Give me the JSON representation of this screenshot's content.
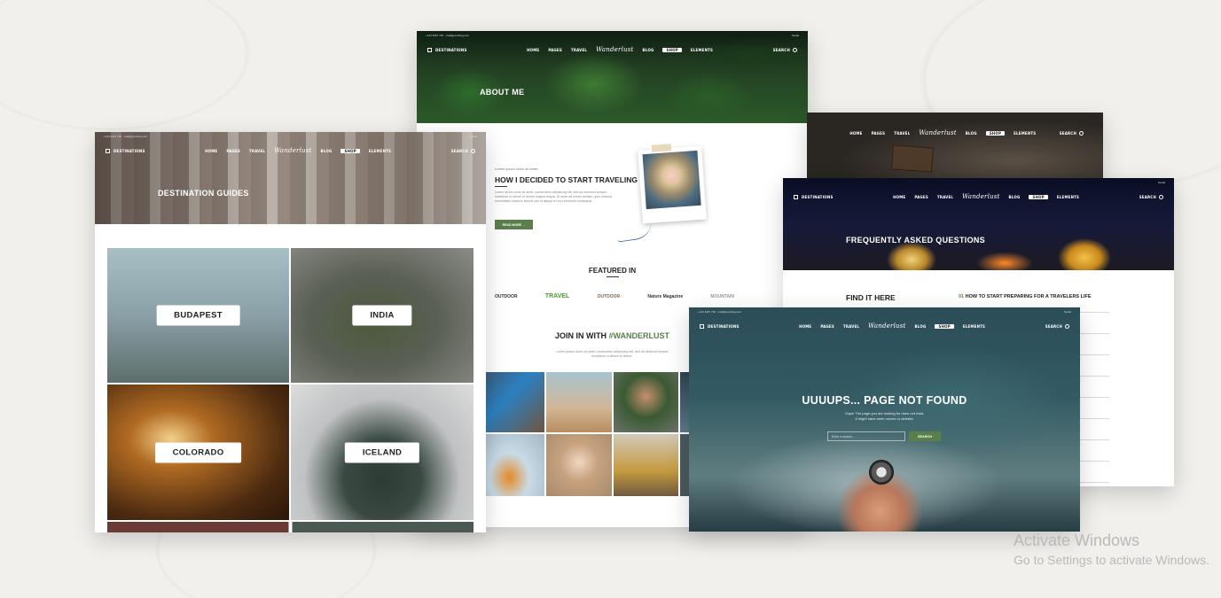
{
  "nav": {
    "destinations": "DESTINATIONS",
    "home": "HOME",
    "pages": "PAGES",
    "travel": "TRAVEL",
    "logo": "Wanderlust",
    "blog": "BLOG",
    "shop": "SHOP",
    "elements": "ELEMENTS",
    "search": "SEARCH",
    "phone": "+123 4467 720",
    "email": "mail@yourblog.com",
    "social": "Social"
  },
  "guides": {
    "title": "DESTINATION GUIDES",
    "tiles": [
      {
        "label": "BUDAPEST",
        "color": "#8ba2a8"
      },
      {
        "label": "INDIA",
        "color": "#5e6355"
      },
      {
        "label": "COLORADO",
        "color": "#6b3c16"
      },
      {
        "label": "ICELAND",
        "color": "#9ea0a2"
      }
    ]
  },
  "about": {
    "hero_title": "ABOUT ME",
    "kicker": "Lorem ipsum dolor sit amet",
    "heading": "HOW I DECIDED TO START TRAVELING",
    "body": "Lorem ipsum dolor sit amet, consectetur adipiscing elit, sed do eiusmod tempor incididunt ut labore et dolore magna aliqua. Ut enim ad minim veniam, quis nostrud exercitation ullamco laboris nisi ut aliquip ex ea commodo consequat.",
    "read_more": "READ MORE",
    "featured_title": "FEATURED IN",
    "featured_logos": [
      "OUTDOOR",
      "TRAVEL",
      "OUTDOOR",
      "Nature Magazine",
      "MOUNTAIN"
    ],
    "join_prefix": "JOIN IN WITH",
    "join_hashtag": "#WANDERLUST",
    "join_body": "Lorem ipsum dolor sit amet, consectetur adipiscing elit, sed do eiusmod tempor incididunt ut labore et dolore.",
    "accent": "#5b7f4b"
  },
  "faq": {
    "hero_title": "FREQUENTLY ASKED QUESTIONS",
    "find_title": "FIND IT HERE",
    "q_num": "01",
    "question": "HOW TO START PREPARING FOR A TRAVELERS LIFE"
  },
  "notfound": {
    "title": "UUUUPS... PAGE NOT FOUND",
    "line1": "Oops! The page you are looking for does not exist.",
    "line2": "It might have been moved or deleted.",
    "placeholder": "Enter a search...",
    "button": "SEARCH"
  },
  "windows": {
    "line1": "Activate Windows",
    "line2": "Go to Settings to activate Windows."
  }
}
